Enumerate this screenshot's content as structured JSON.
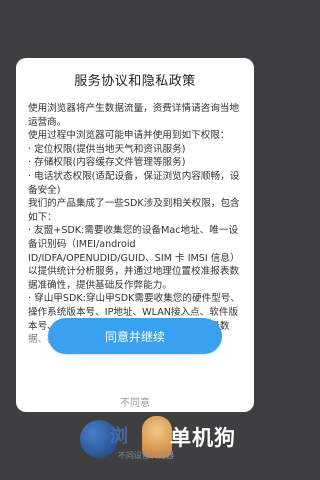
{
  "dialog": {
    "title": "服务协议和隐私政策",
    "paragraphs": [
      "    使用浏览器将产生数据流量，资费详情请咨询当地运营商。",
      "    使用过程中浏览器可能申请并使用到如下权限：",
      "· 定位权限(提供当地天气和资讯服务)",
      "· 存储权限(内容缓存文件管理等服务)",
      "· 电话状态权限(适配设备，保证浏览内容顺畅，设备安全)",
      "    我们的产品集成了一些SDK涉及到相关权限，包含如下：",
      "· 友盟+SDK:需要收集您的设备Mac地址、唯一设备识别码（IMEI/android ID/IDFA/OPENUDID/GUID、SIM 卡 IMSI 信息）以提供统计分析服务，并通过地理位置校准报表数据准确性，提供基础反作弊能力。",
      "· 穿山甲SDK:穿山甲SDK需要收集您的硬件型号、操作系统版本号、IP地址、WLAN接入点、软件版本号、网络接入方式、类型、状态、网络质量数据、操作日志、服务日志"
    ],
    "agree_label": "同意并继续",
    "disagree_label": "不同意"
  },
  "watermark": {
    "browser_text": "浏",
    "brand": "单机狗",
    "slogan": "不同设备浏览器"
  }
}
